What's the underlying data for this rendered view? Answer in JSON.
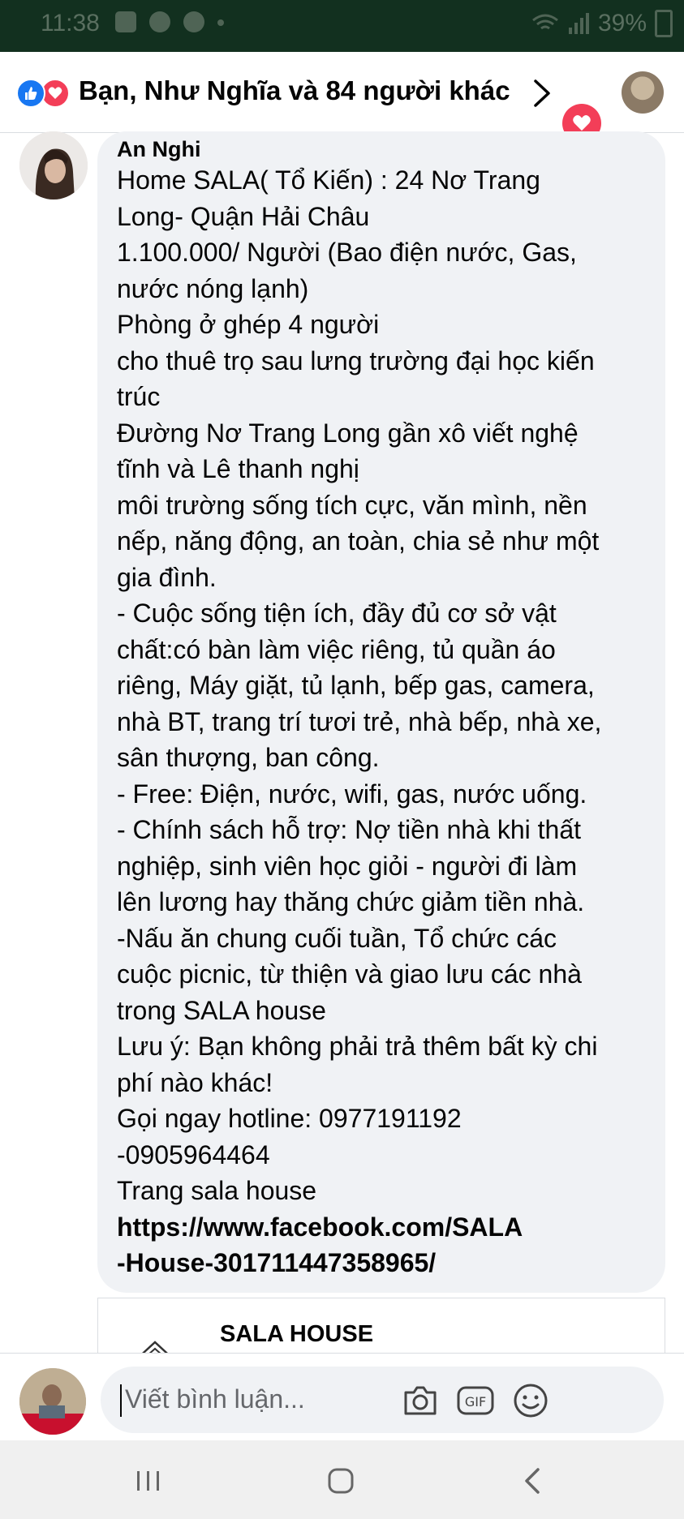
{
  "status_bar": {
    "time": "11:38",
    "battery": "39%"
  },
  "header": {
    "reactions_summary": "Bạn, Như Nghĩa và 84 người khác"
  },
  "comment": {
    "author": "An Nghi",
    "lines": [
      "Home SALA( Tổ Kiến) : 24 Nơ Trang",
      "Long- Quận Hải Châu",
      "1.100.000/ Người (Bao điện nước, Gas,",
      "nước nóng lạnh)",
      "Phòng ở ghép 4 người",
      "cho thuê trọ sau lưng trường đại học kiến",
      "trúc",
      "Đường Nơ Trang Long gần xô viết nghệ",
      "tĩnh và Lê thanh nghị",
      "môi trường sống tích cực, văn mình, nền",
      "nếp, năng động, an toàn, chia sẻ như một",
      "gia đình.",
      "- Cuộc sống tiện ích, đầy đủ cơ sở vật",
      "chất:có bàn làm việc riêng, tủ quần áo",
      "riêng, Máy giặt, tủ lạnh, bếp gas, camera,",
      "nhà BT, trang trí tươi trẻ, nhà bếp, nhà xe,",
      "sân thượng, ban công.",
      "- Free: Điện, nước, wifi, gas, nước uống.",
      "- Chính sách hỗ trợ: Nợ tiền nhà khi thất",
      "nghiệp, sinh viên học giỏi - người đi làm",
      "lên lương hay thăng chức giảm tiền nhà.",
      "-Nấu ăn chung cuối tuần, Tổ chức các",
      "cuộc picnic, từ thiện và giao lưu các nhà",
      "trong SALA house",
      "Lưu ý: Bạn không phải trả thêm bất kỳ chi",
      "phí nào khác!",
      "Gọi ngay hotline: 0977191192",
      "-0905964464",
      "Trang sala house"
    ],
    "link_lines": [
      "https://www.facebook.com/SALA",
      "-House-301711447358965/"
    ]
  },
  "link_preview": {
    "title": "SALA HOUSE"
  },
  "composer": {
    "placeholder": "Viết bình luận..."
  },
  "icons": {
    "like": "like-icon",
    "love": "love-icon",
    "camera": "camera-icon",
    "gif": "gif-icon",
    "emoji": "emoji-icon",
    "chevron": "chevron-right-icon"
  },
  "colors": {
    "status_bar": "#12301f",
    "like_blue": "#1877f2",
    "love_red": "#f33e58",
    "bubble": "#f0f2f5"
  }
}
